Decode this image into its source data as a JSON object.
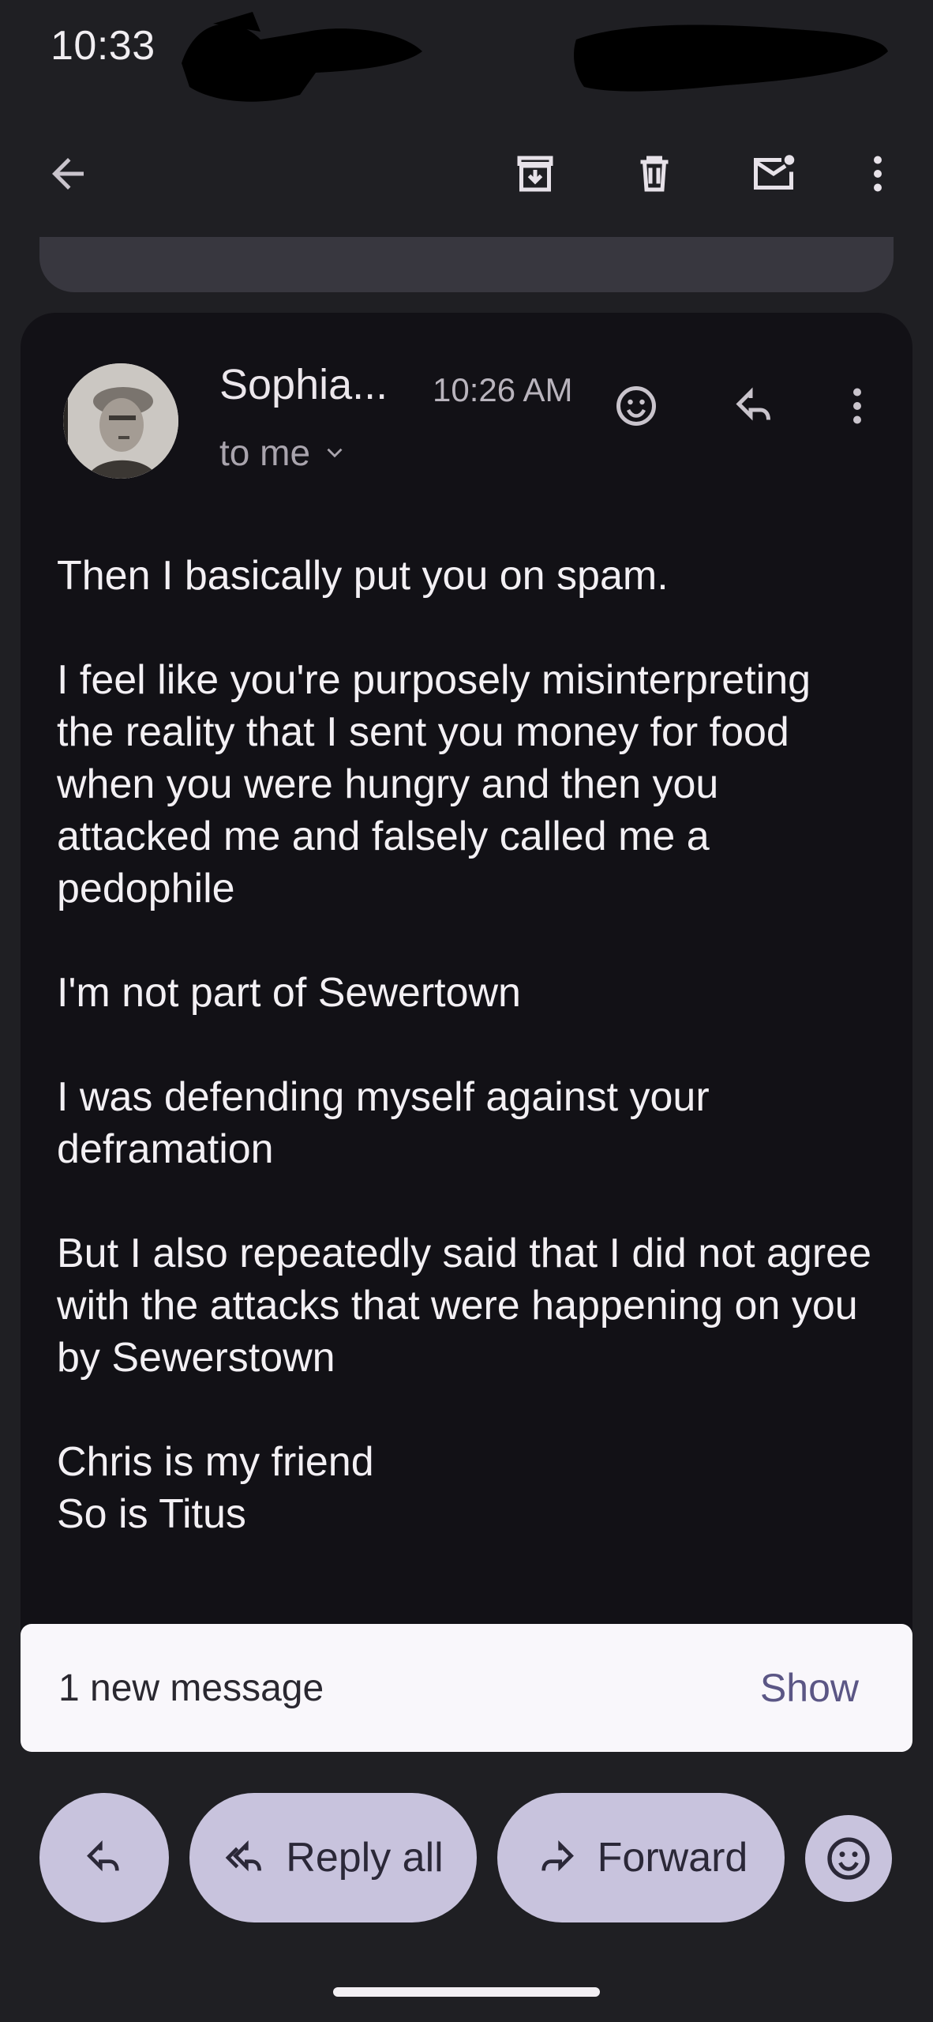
{
  "status_bar": {
    "time": "10:33"
  },
  "colors": {
    "background": "#1f1f23",
    "card": "#121116",
    "pill": "#c8c3dd",
    "snackbar": "#f9f7fb",
    "snackbar_action": "#5b5685"
  },
  "app_bar": {
    "icons": [
      "back-arrow-icon",
      "archive-icon",
      "trash-icon",
      "mark-unread-icon",
      "more-vert-icon"
    ]
  },
  "message": {
    "sender": "Sophia...",
    "time": "10:26 AM",
    "recipient": "to me",
    "paragraphs": [
      "Then I basically put you on spam.",
      "I feel like you're purposely misinterpreting the reality that I sent you money for food when you were hungry and then you attacked me and falsely called me a pedophile",
      "I'm not part of Sewertown",
      "I was defending myself against your deframation",
      "But I also repeatedly said that I did not agree with the attacks that were happening on you by Sewerstown",
      "Chris is my friend",
      "So is Titus"
    ]
  },
  "snackbar": {
    "text": "1 new message",
    "action": "Show"
  },
  "bottom_actions": {
    "reply_all": "Reply all",
    "forward": "Forward"
  }
}
